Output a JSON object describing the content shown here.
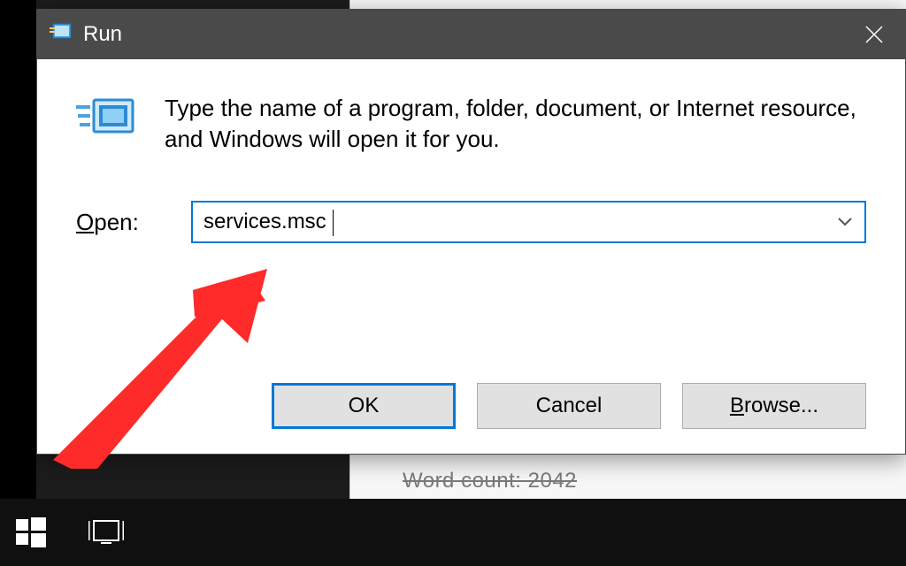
{
  "dialog": {
    "title": "Run",
    "description": "Type the name of a program, folder, document, or Internet resource, and Windows will open it for you.",
    "open_label_prefix": "O",
    "open_label_rest": "pen:",
    "input_value": "services.msc",
    "buttons": {
      "ok": "OK",
      "cancel": "Cancel",
      "browse_prefix": "B",
      "browse_rest": "rowse..."
    }
  },
  "background": {
    "doc_text": "Word count: 2042"
  }
}
